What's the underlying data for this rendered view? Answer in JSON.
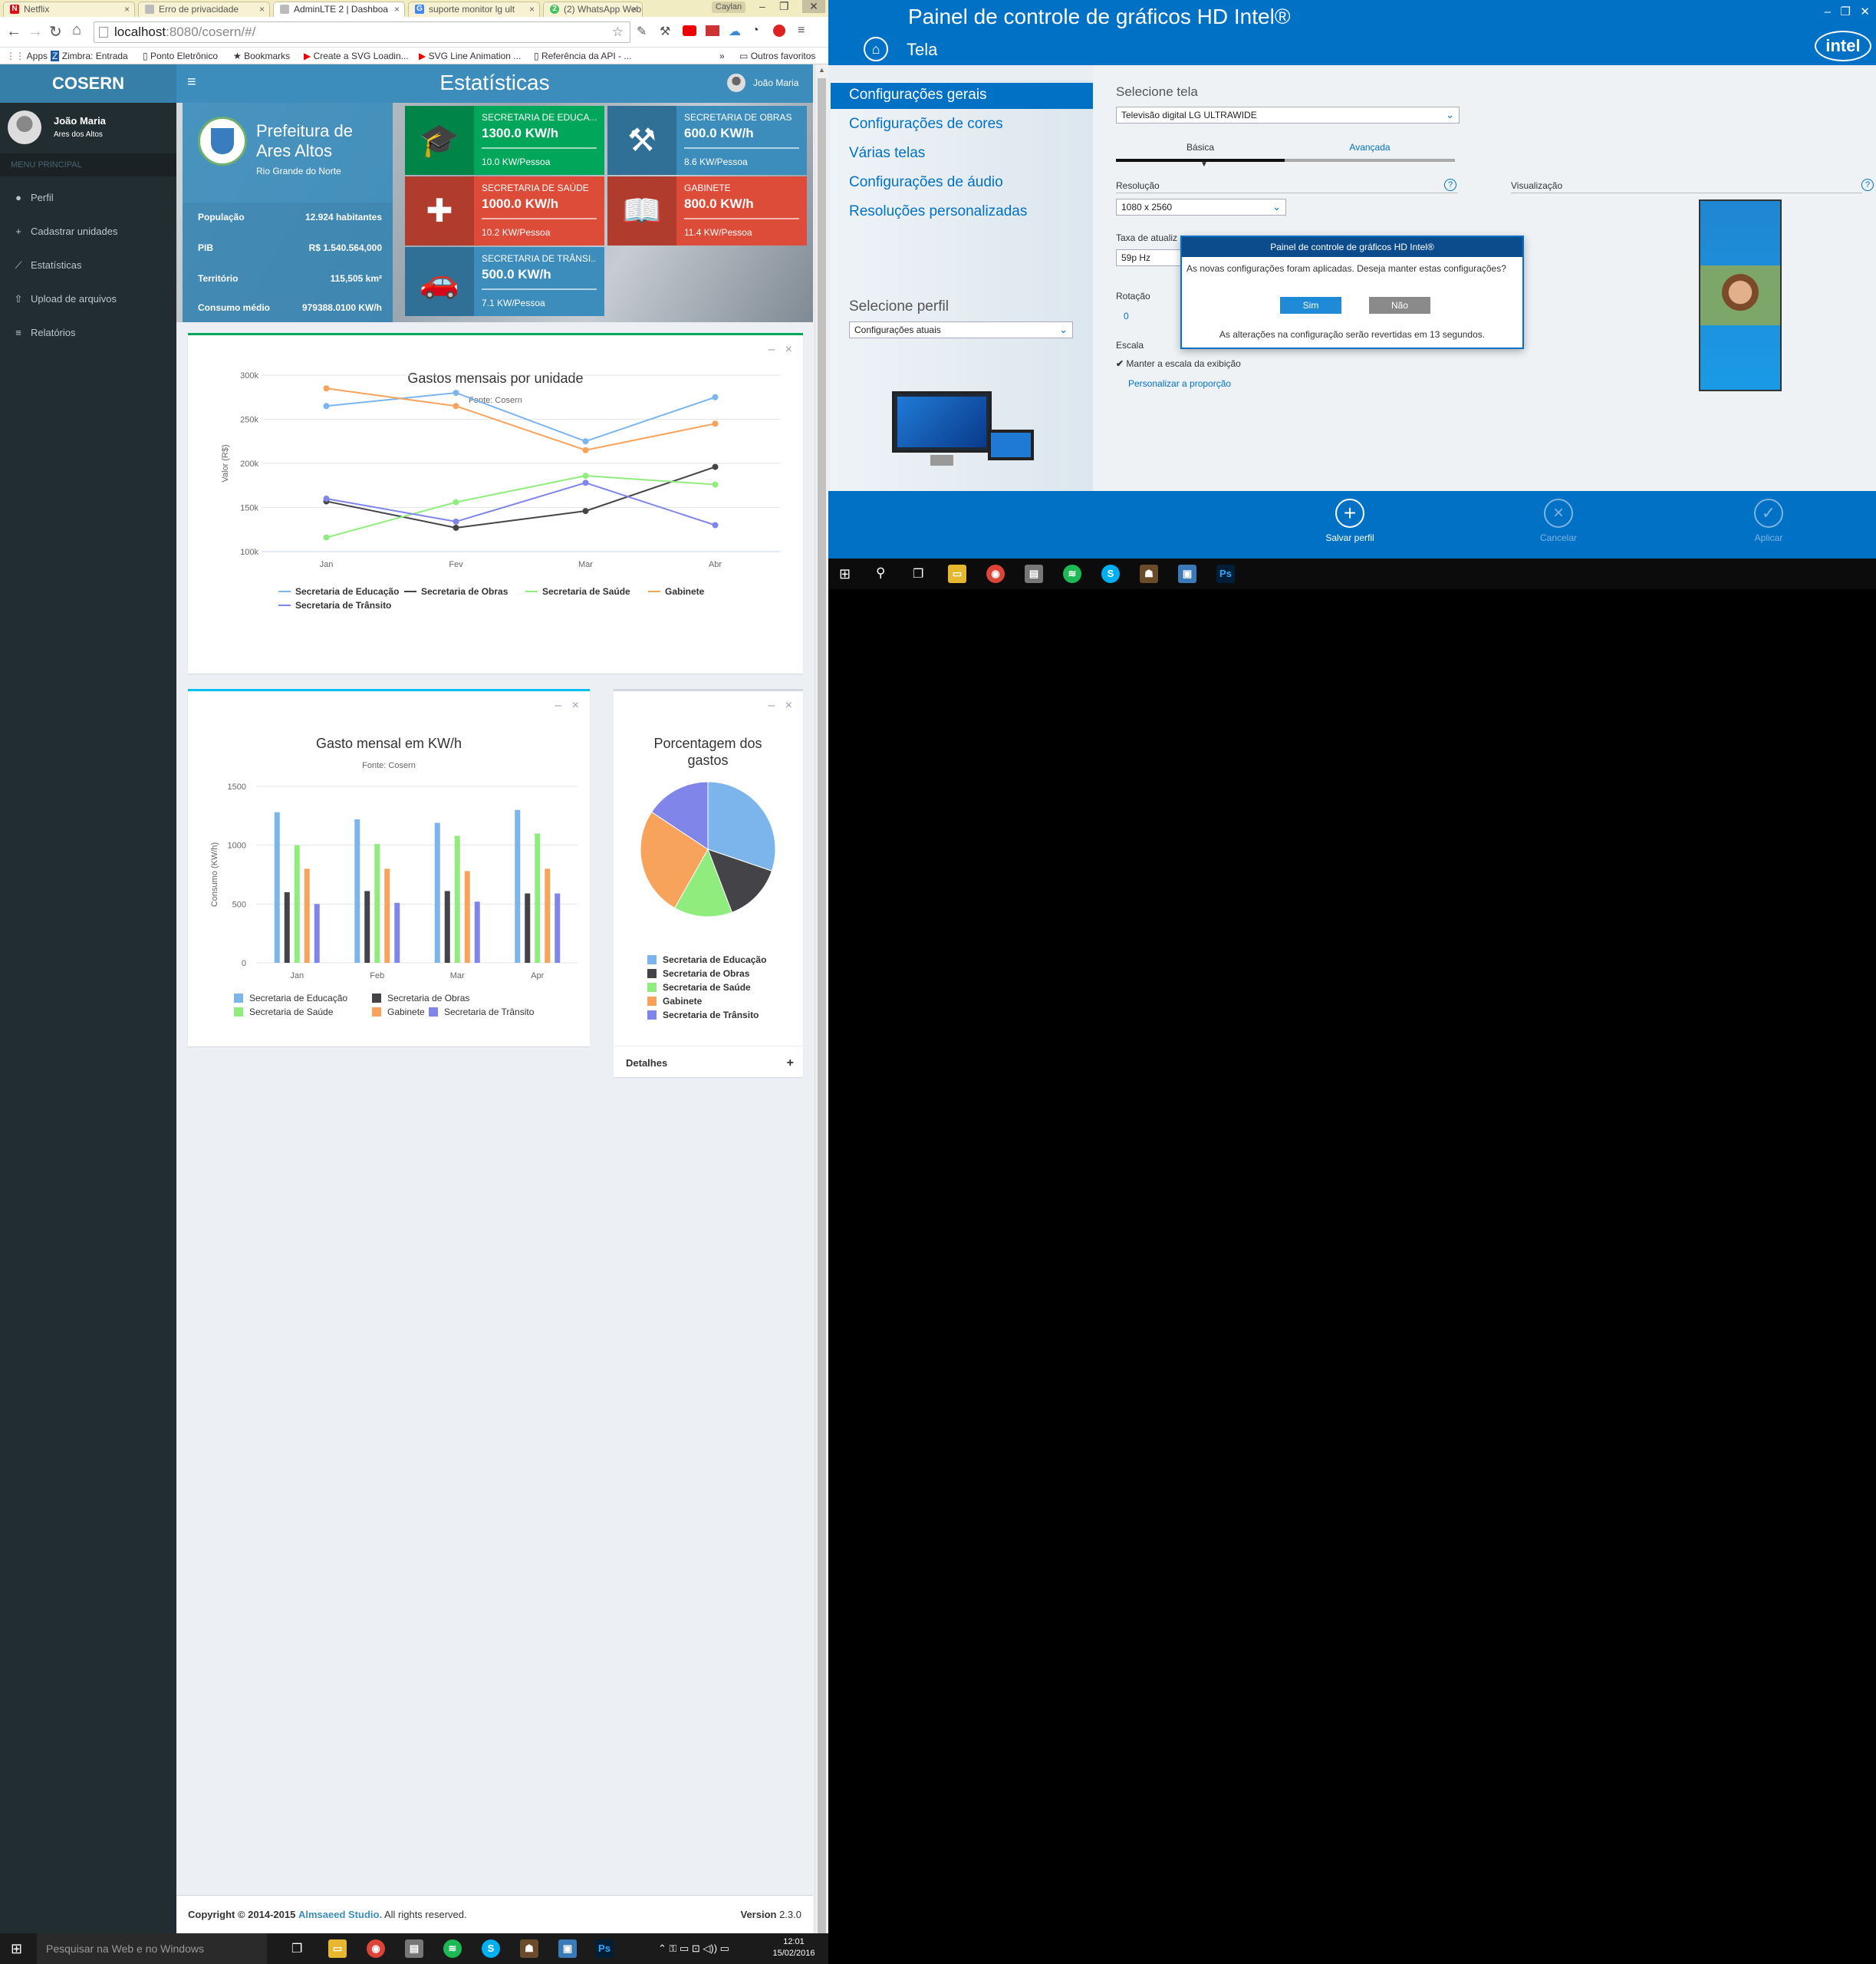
{
  "browser": {
    "tabs": [
      {
        "label": "Netflix",
        "icon": "netflix-icon",
        "color": "#e50914"
      },
      {
        "label": "Erro de privacidade",
        "icon": "page-icon",
        "color": "#999999"
      },
      {
        "label": "AdminLTE 2 | Dashboa",
        "icon": "page-icon",
        "color": "#999999"
      },
      {
        "label": "suporte monitor lg ult",
        "icon": "google-icon",
        "color": "#4285f4"
      },
      {
        "label": "(2) WhatsApp Web",
        "icon": "whatsapp-icon",
        "color": "#43c55a"
      }
    ],
    "profile": "Caylan",
    "url_host": "localhost",
    "url_rest": ":8080/cosern/#/",
    "bookmarks": [
      "Apps",
      "Zimbra: Entrada",
      "Ponto Eletrônico",
      "Bookmarks",
      "Create a SVG Loadin...",
      "SVG Line Animation ...",
      "Referência da API - ..."
    ],
    "other_bookmarks": "Outros favoritos"
  },
  "app": {
    "logo": "COSERN",
    "page_title": "Estatísticas",
    "user_name": "João Maria",
    "user_sub": "Ares dos Altos",
    "menu_header": "MENU PRINCIPAL",
    "menu": [
      {
        "label": "Perfil",
        "icon": "user-icon"
      },
      {
        "label": "Cadastrar unidades",
        "icon": "plus-icon"
      },
      {
        "label": "Estatísticas",
        "icon": "line-chart-icon"
      },
      {
        "label": "Upload de arquivos",
        "icon": "upload-icon"
      },
      {
        "label": "Relatórios",
        "icon": "list-icon"
      }
    ]
  },
  "prefeitura": {
    "title_1": "Prefeitura de",
    "title_2": "Ares Altos",
    "state": "Rio Grande do Norte",
    "stats": [
      {
        "label": "População",
        "value": "12.924 habitantes"
      },
      {
        "label": "PIB",
        "value": "R$ 1.540.564,000"
      },
      {
        "label": "Território",
        "value": "115,505 km²"
      },
      {
        "label": "Consumo médio",
        "value": "979388.0100 KW/h"
      }
    ]
  },
  "infoboxes": [
    {
      "title": "SECRETARIA DE EDUCA...",
      "value": "1300.0 KW/h",
      "sub": "10.0 KW/Pessoa",
      "color": "#00a65a",
      "icon": "graduation-cap-icon"
    },
    {
      "title": "SECRETARIA DE OBRAS",
      "value": "600.0 KW/h",
      "sub": "8.6 KW/Pessoa",
      "color": "#3c8dbc",
      "icon": "worker-icon"
    },
    {
      "title": "SECRETARIA DE SAÚDE",
      "value": "1000.0 KW/h",
      "sub": "10.2 KW/Pessoa",
      "color": "#dd4b39",
      "icon": "medkit-icon"
    },
    {
      "title": "GABINETE",
      "value": "800.0 KW/h",
      "sub": "11.4 KW/Pessoa",
      "color": "#dd4b39",
      "icon": "book-icon"
    },
    {
      "title": "SECRETARIA DE TRÂNSI...",
      "value": "500.0 KW/h",
      "sub": "7.1 KW/Pessoa",
      "color": "#3c8dbc",
      "icon": "car-icon"
    }
  ],
  "chart_data": [
    {
      "type": "line",
      "title": "Gastos mensais por unidade",
      "subtitle": "Fonte: Cosern",
      "ylabel": "Valor (R$)",
      "categories": [
        "Jan",
        "Fev",
        "Mar",
        "Abr"
      ],
      "ylim": [
        100000,
        300000
      ],
      "yticks": [
        "100k",
        "150k",
        "200k",
        "250k",
        "300k"
      ],
      "series": [
        {
          "name": "Secretaria de Educação",
          "color": "#7cb5ec",
          "marker": "circle",
          "values": [
            265000,
            280000,
            225000,
            275000
          ]
        },
        {
          "name": "Secretaria de Obras",
          "color": "#434348",
          "marker": "diamond",
          "values": [
            157000,
            127000,
            146000,
            196000
          ]
        },
        {
          "name": "Secretaria de Saúde",
          "color": "#90ed7d",
          "marker": "square",
          "values": [
            116000,
            156000,
            186000,
            176000
          ]
        },
        {
          "name": "Gabinete",
          "color": "#f7a35c",
          "marker": "triangle",
          "values": [
            285000,
            265000,
            215000,
            245000
          ]
        },
        {
          "name": "Secretaria de Trânsito",
          "color": "#8085e9",
          "marker": "triangle-down",
          "values": [
            160000,
            134000,
            178000,
            130000
          ]
        }
      ]
    },
    {
      "type": "bar",
      "title": "Gasto mensal em KW/h",
      "subtitle": "Fonte: Cosern",
      "ylabel": "Consumo (KW/h)",
      "categories": [
        "Jan",
        "Feb",
        "Mar",
        "Apr"
      ],
      "ylim": [
        0,
        1500
      ],
      "yticks": [
        "0",
        "500",
        "1000",
        "1500"
      ],
      "series": [
        {
          "name": "Secretaria de Educação",
          "color": "#7cb5ec",
          "values": [
            1280,
            1220,
            1190,
            1300
          ]
        },
        {
          "name": "Secretaria de Obras",
          "color": "#434348",
          "values": [
            600,
            610,
            610,
            590
          ]
        },
        {
          "name": "Secretaria de Saúde",
          "color": "#90ed7d",
          "values": [
            1000,
            1010,
            1080,
            1100
          ]
        },
        {
          "name": "Gabinete",
          "color": "#f7a35c",
          "values": [
            800,
            800,
            780,
            800
          ]
        },
        {
          "name": "Secretaria de Trânsito",
          "color": "#8085e9",
          "values": [
            500,
            510,
            520,
            590
          ]
        }
      ]
    },
    {
      "type": "pie",
      "title_1": "Porcentagem dos",
      "title_2": "gastos",
      "series": [
        {
          "name": "Secretaria de Educação",
          "color": "#7cb5ec",
          "value": 30.2
        },
        {
          "name": "Secretaria de Obras",
          "color": "#434348",
          "value": 14.0
        },
        {
          "name": "Secretaria de Saúde",
          "color": "#90ed7d",
          "value": 14.0
        },
        {
          "name": "Gabinete",
          "color": "#f7a35c",
          "value": 26.1
        },
        {
          "name": "Secretaria de Trânsito",
          "color": "#8085e9",
          "value": 15.7
        }
      ]
    }
  ],
  "pie_box": {
    "footer": "Detalhes"
  },
  "footer": {
    "copyright": "Copyright © 2014-2015",
    "company": "Almsaeed Studio.",
    "rights": " All rights reserved.",
    "version_label": "Version",
    "version": "2.3.0"
  },
  "taskbar_left": {
    "search": "Pesquisar na Web e no Windows",
    "time": "12:01",
    "date": "15/02/2016"
  },
  "intel": {
    "title": "Painel de controle de gráficos HD Intel®",
    "section": "Tela",
    "brand": "intel",
    "nav": [
      "Configurações gerais",
      "Configurações de cores",
      "Várias telas",
      "Configurações de áudio",
      "Resoluções personalizadas"
    ],
    "profile_label": "Selecione perfil",
    "profile_value": "Configurações atuais",
    "select_screen_label": "Selecione tela",
    "select_screen_value": "Televisão digital LG ULTRAWIDE",
    "tab_basic": "Básica",
    "tab_advanced": "Avançada",
    "resolution_label": "Resolução",
    "resolution_value": "1080 x 2560",
    "refresh_label": "Taxa de atualiz",
    "refresh_value": "59p Hz",
    "rotation_label": "Rotação",
    "rotation_value": "0",
    "scale_label": "Escala",
    "keep_scale": "Manter a escala da exibição",
    "custom_aspect": "Personalizar a proporção",
    "preview_label": "Visualização",
    "dialog": {
      "title": "Painel de controle de gráficos HD Intel®",
      "message": "As novas configurações foram aplicadas. Deseja manter estas configurações?",
      "yes": "Sim",
      "no": "Não",
      "countdown": "As alterações na configuração serão revertidas em 13 segundos."
    },
    "footer_buttons": [
      "Salvar perfil",
      "Cancelar",
      "Aplicar"
    ]
  }
}
